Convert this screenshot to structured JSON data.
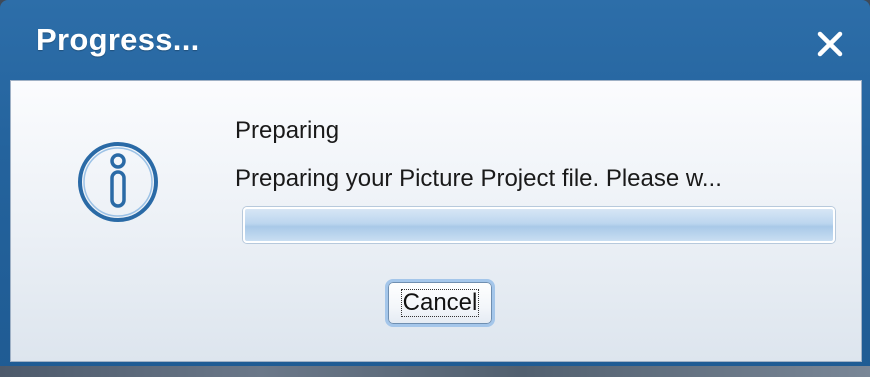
{
  "window": {
    "title": "Progress...",
    "close_icon": "close-icon"
  },
  "content": {
    "icon": "info-icon",
    "heading": "Preparing",
    "message": "Preparing your Picture Project file. Please w...",
    "progress_fraction": 0.0
  },
  "buttons": {
    "cancel_label": "Cancel"
  },
  "colors": {
    "titlebar": "#24639d",
    "icon_accent": "#2a6aa6",
    "progress_track": "#bcd6ef"
  }
}
